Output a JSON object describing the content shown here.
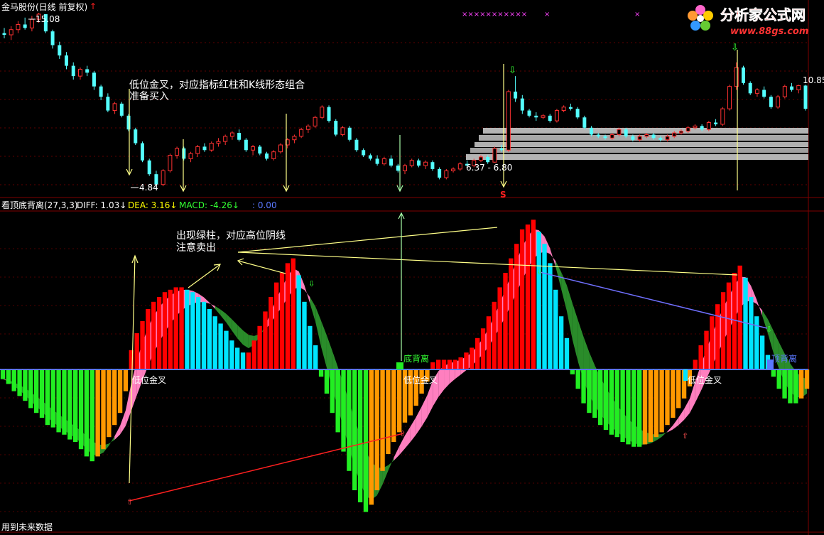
{
  "header": {
    "stock_title": "金马股份(日线 前复权)",
    "title_arrow": "↑",
    "price_max_label": "15.08",
    "price_min_label": "4.84",
    "right_price_label": "10.85",
    "range_label": "6.37 - 6.80"
  },
  "indicator_bar": {
    "name": "看顶底背离(27,3,3)",
    "diff": "DIFF: 1.03↓",
    "dea": "DEA: 3.16↓",
    "macd": "MACD: -4.26↓",
    "extra": ": 0.00"
  },
  "annotations": {
    "buy_note_line1": "低位金叉，对应指标红柱和K线形态组合",
    "buy_note_line2": "准备买入",
    "sell_note_line1": "出现绿柱，对应高位阴线",
    "sell_note_line2": "注意卖出",
    "golden_cross_1": "低位金叉",
    "golden_cross_2": "低位金叉",
    "golden_cross_3": "低位金叉",
    "bottom_divergence": "底背离",
    "top_divergence": "顶背离",
    "s_marker": "S",
    "top_markers": "×××××××××××",
    "top_marker_2": "×",
    "top_marker_3": "×",
    "footer_note": "用到未来数据"
  },
  "watermark": {
    "text": "分析家公式网",
    "url": "www.88gs.com"
  },
  "colors": {
    "up": "#ff3232",
    "down": "#54ffff",
    "macd_red": "#ff0000",
    "macd_cyan": "#00e5ff",
    "macd_green": "#22ee22",
    "macd_orange": "#ff9900",
    "band_pink": "#ff7fbf",
    "band_green": "#2a8c2a",
    "annotation": "#ffff99"
  },
  "chart_data": {
    "type": "candlestick+histogram",
    "price_panel": {
      "ylim": [
        4.84,
        15.08
      ],
      "labeled_high": 15.08,
      "labeled_low": 4.84,
      "labeled_right": 10.85,
      "ohlc": [
        [
          13.9,
          14.2,
          13.6,
          13.8
        ],
        [
          13.8,
          14.3,
          13.5,
          14.1
        ],
        [
          14.1,
          14.6,
          13.9,
          14.4
        ],
        [
          14.4,
          14.8,
          14.1,
          14.2
        ],
        [
          14.2,
          14.9,
          14.0,
          14.7
        ],
        [
          14.7,
          15.08,
          14.5,
          15.0
        ],
        [
          15.0,
          15.0,
          13.9,
          14.0
        ],
        [
          14.0,
          14.1,
          13.0,
          13.2
        ],
        [
          13.2,
          13.4,
          12.4,
          12.6
        ],
        [
          12.6,
          12.8,
          11.8,
          12.0
        ],
        [
          12.0,
          12.2,
          11.2,
          11.4
        ],
        [
          11.4,
          11.9,
          11.2,
          11.8
        ],
        [
          11.8,
          12.0,
          11.4,
          11.6
        ],
        [
          11.6,
          11.7,
          10.6,
          10.8
        ],
        [
          10.8,
          10.9,
          10.0,
          10.2
        ],
        [
          10.2,
          10.4,
          9.3,
          9.4
        ],
        [
          9.4,
          9.9,
          9.2,
          9.8
        ],
        [
          9.8,
          9.9,
          9.0,
          9.1
        ],
        [
          9.1,
          9.2,
          8.2,
          8.3
        ],
        [
          8.3,
          8.4,
          7.4,
          7.5
        ],
        [
          7.5,
          7.6,
          6.4,
          6.5
        ],
        [
          6.5,
          6.6,
          5.6,
          5.7
        ],
        [
          5.7,
          5.9,
          4.84,
          5.1
        ],
        [
          5.1,
          6.0,
          5.0,
          5.9
        ],
        [
          5.9,
          6.9,
          5.8,
          6.8
        ],
        [
          6.8,
          7.3,
          6.6,
          7.2
        ],
        [
          7.2,
          7.3,
          6.5,
          6.6
        ],
        [
          6.6,
          7.0,
          6.4,
          6.9
        ],
        [
          6.9,
          7.4,
          6.7,
          7.3
        ],
        [
          7.3,
          7.5,
          7.0,
          7.1
        ],
        [
          7.1,
          7.6,
          7.0,
          7.5
        ],
        [
          7.5,
          7.8,
          7.3,
          7.6
        ],
        [
          7.6,
          8.0,
          7.4,
          7.9
        ],
        [
          7.9,
          8.2,
          7.7,
          8.1
        ],
        [
          8.1,
          8.3,
          7.6,
          7.7
        ],
        [
          7.7,
          7.8,
          7.0,
          7.1
        ],
        [
          7.1,
          7.4,
          6.8,
          7.3
        ],
        [
          7.3,
          7.4,
          6.8,
          6.9
        ],
        [
          6.9,
          7.0,
          6.5,
          6.6
        ],
        [
          6.6,
          7.1,
          6.5,
          7.0
        ],
        [
          7.0,
          7.5,
          6.9,
          7.4
        ],
        [
          7.4,
          7.8,
          7.2,
          7.7
        ],
        [
          7.7,
          8.0,
          7.5,
          7.9
        ],
        [
          7.9,
          8.4,
          7.8,
          8.3
        ],
        [
          8.3,
          8.6,
          8.1,
          8.5
        ],
        [
          8.5,
          9.1,
          8.4,
          9.0
        ],
        [
          9.0,
          9.7,
          8.9,
          9.6
        ],
        [
          9.6,
          9.7,
          8.7,
          8.8
        ],
        [
          8.8,
          8.9,
          7.9,
          8.0
        ],
        [
          8.0,
          8.5,
          7.9,
          8.4
        ],
        [
          8.4,
          8.5,
          7.6,
          7.7
        ],
        [
          7.7,
          7.8,
          7.0,
          7.1
        ],
        [
          7.1,
          7.2,
          6.7,
          6.8
        ],
        [
          6.8,
          6.9,
          6.5,
          6.6
        ],
        [
          6.6,
          6.8,
          6.2,
          6.3
        ],
        [
          6.3,
          6.7,
          6.2,
          6.6
        ],
        [
          6.6,
          6.8,
          6.1,
          6.2
        ],
        [
          6.2,
          6.3,
          5.8,
          5.9
        ],
        [
          5.9,
          6.3,
          5.7,
          6.2
        ],
        [
          6.2,
          6.6,
          6.1,
          6.5
        ],
        [
          6.5,
          6.6,
          6.1,
          6.2
        ],
        [
          6.2,
          6.5,
          6.0,
          6.4
        ],
        [
          6.4,
          6.5,
          5.9,
          6.0
        ],
        [
          6.0,
          6.1,
          5.4,
          5.5
        ],
        [
          5.5,
          6.0,
          5.4,
          5.9
        ],
        [
          5.9,
          6.1,
          5.8,
          6.0
        ],
        [
          6.0,
          6.4,
          5.9,
          6.3
        ],
        [
          6.3,
          6.5,
          6.1,
          6.2
        ],
        [
          6.2,
          6.6,
          6.1,
          6.5
        ],
        [
          6.5,
          6.8,
          6.4,
          6.7
        ],
        [
          6.7,
          6.8,
          6.3,
          6.4
        ],
        [
          6.4,
          7.3,
          6.37,
          7.2
        ],
        [
          7.2,
          7.4,
          7.0,
          7.1
        ],
        [
          7.1,
          10.6,
          7.0,
          10.5
        ],
        [
          10.5,
          11.4,
          9.9,
          10.1
        ],
        [
          10.1,
          10.3,
          9.2,
          9.4
        ],
        [
          9.4,
          9.5,
          9.0,
          9.1
        ],
        [
          9.1,
          9.3,
          8.8,
          9.0
        ],
        [
          9.0,
          9.2,
          8.9,
          9.1
        ],
        [
          9.1,
          9.2,
          8.7,
          8.8
        ],
        [
          8.8,
          9.5,
          8.7,
          9.4
        ],
        [
          9.4,
          9.7,
          9.3,
          9.6
        ],
        [
          9.6,
          9.8,
          9.4,
          9.5
        ],
        [
          9.5,
          9.6,
          8.9,
          9.0
        ],
        [
          9.0,
          9.1,
          8.3,
          8.4
        ],
        [
          8.4,
          8.5,
          7.9,
          8.0
        ],
        [
          8.0,
          8.1,
          7.8,
          7.9
        ],
        [
          7.9,
          8.0,
          7.7,
          7.8
        ],
        [
          7.8,
          8.1,
          7.7,
          8.0
        ],
        [
          8.0,
          8.4,
          7.9,
          8.3
        ],
        [
          8.3,
          8.4,
          7.8,
          7.9
        ],
        [
          7.9,
          8.0,
          7.6,
          7.7
        ],
        [
          7.7,
          8.0,
          7.6,
          7.9
        ],
        [
          7.9,
          8.1,
          7.8,
          8.0
        ],
        [
          8.0,
          8.1,
          7.7,
          7.8
        ],
        [
          7.8,
          7.9,
          7.6,
          7.7
        ],
        [
          7.7,
          8.0,
          7.6,
          7.9
        ],
        [
          7.9,
          8.2,
          7.8,
          8.1
        ],
        [
          8.1,
          8.3,
          8.0,
          8.2
        ],
        [
          8.2,
          8.5,
          8.1,
          8.4
        ],
        [
          8.4,
          8.6,
          8.3,
          8.5
        ],
        [
          8.5,
          8.6,
          8.2,
          8.3
        ],
        [
          8.3,
          8.8,
          8.2,
          8.7
        ],
        [
          8.7,
          8.9,
          8.5,
          8.6
        ],
        [
          8.6,
          9.6,
          8.5,
          9.5
        ],
        [
          9.5,
          10.9,
          9.4,
          10.8
        ],
        [
          10.8,
          12.2,
          10.6,
          11.9
        ],
        [
          11.9,
          12.0,
          10.9,
          11.0
        ],
        [
          11.0,
          11.1,
          10.3,
          10.4
        ],
        [
          10.4,
          10.7,
          10.2,
          10.6
        ],
        [
          10.6,
          10.8,
          10.1,
          10.2
        ],
        [
          10.2,
          10.3,
          9.5,
          9.6
        ],
        [
          9.6,
          10.3,
          9.5,
          10.2
        ],
        [
          10.2,
          10.9,
          10.1,
          10.8
        ],
        [
          10.8,
          11.0,
          10.5,
          10.6
        ],
        [
          10.6,
          10.9,
          10.4,
          10.85
        ],
        [
          10.85,
          10.9,
          9.4,
          9.5
        ]
      ]
    },
    "macd_panel": {
      "ylim": [
        -6.5,
        6.2
      ],
      "histogram": [
        -0.4,
        -0.6,
        -0.9,
        -1.1,
        -1.3,
        -1.6,
        -1.8,
        -2.0,
        -2.3,
        -2.4,
        -2.6,
        -2.7,
        -2.9,
        -3.0,
        -3.3,
        -3.6,
        -3.8,
        -3.6,
        -3.3,
        -2.8,
        -2.3,
        -1.8,
        -0.9,
        0.8,
        1.5,
        2.0,
        2.5,
        2.8,
        3.0,
        3.2,
        3.3,
        3.4,
        3.4,
        3.3,
        3.2,
        3.0,
        2.8,
        2.5,
        2.2,
        1.9,
        1.6,
        1.2,
        0.9,
        0.7,
        0.7,
        1.2,
        1.8,
        2.4,
        3.0,
        3.6,
        4.0,
        4.4,
        4.6,
        3.9,
        2.8,
        1.8,
        1.0,
        -0.3,
        -1.0,
        -1.8,
        -2.6,
        -3.4,
        -4.2,
        -5.0,
        -5.5,
        -5.9,
        -5.6,
        -5.0,
        -4.2,
        -3.5,
        -3.0,
        -2.6,
        -2.2,
        -1.9,
        -1.5,
        -1.0,
        -0.5,
        0.3,
        0.4,
        0.4,
        0.4,
        0.4,
        0.5,
        0.7,
        0.9,
        1.3,
        1.7,
        2.2,
        2.8,
        3.4,
        4.0,
        4.6,
        5.2,
        5.8,
        6.0,
        6.2,
        5.7,
        5.2,
        4.4,
        3.3,
        2.2,
        1.3,
        -0.2,
        -0.8,
        -1.4,
        -1.8,
        -2.0,
        -2.3,
        -2.5,
        -2.7,
        -2.8,
        -3.0,
        -3.1,
        -3.2,
        -3.2,
        -3.1,
        -3.0,
        -2.8,
        -2.6,
        -2.3,
        -2.0,
        -1.6,
        -1.2,
        -0.7,
        0.4,
        1.0,
        1.6,
        2.2,
        2.7,
        3.2,
        3.6,
        4.0,
        4.3,
        3.8,
        3.0,
        2.2,
        1.4,
        0.6,
        -0.3,
        -0.8,
        -1.2,
        -1.4,
        -1.4,
        -1.2,
        -0.8
      ]
    }
  }
}
